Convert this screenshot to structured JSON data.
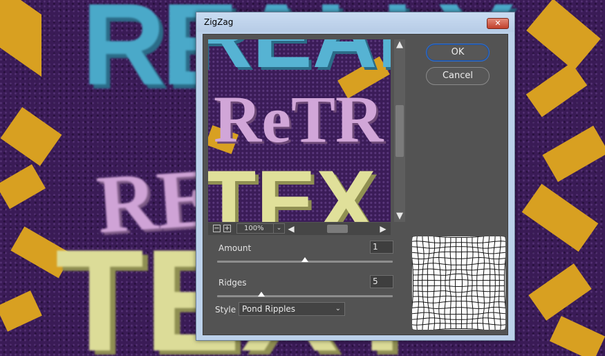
{
  "dialog": {
    "title": "ZigZag",
    "close_glyph": "✕"
  },
  "buttons": {
    "ok_label": "OK",
    "cancel_label": "Cancel"
  },
  "preview": {
    "zoom_out_glyph": "−",
    "zoom_in_glyph": "+",
    "zoom_level": "100%",
    "background_words": [
      "REALLY",
      "ReTR",
      "TEX"
    ]
  },
  "controls": {
    "amount": {
      "label": "Amount",
      "value": "1",
      "slider_fraction": 0.5
    },
    "ridges": {
      "label": "Ridges",
      "value": "5",
      "slider_fraction": 0.25
    },
    "style": {
      "label": "Style",
      "selected": "Pond Ripples"
    }
  },
  "background": {
    "words": [
      "REALLY",
      "RETRO",
      "TEXT"
    ]
  },
  "icons": {
    "scroll_up": "scroll-up-icon",
    "scroll_down": "scroll-down-icon",
    "scroll_left": "scroll-left-icon",
    "scroll_right": "scroll-right-icon",
    "chevron": "chevron-down-icon"
  },
  "colors": {
    "panel": "#535353",
    "ok_border": "#2f6fd0",
    "close_red": "#c1402b",
    "zig_yellow": "#d8a021",
    "bg_purple": "#3a1b56"
  }
}
